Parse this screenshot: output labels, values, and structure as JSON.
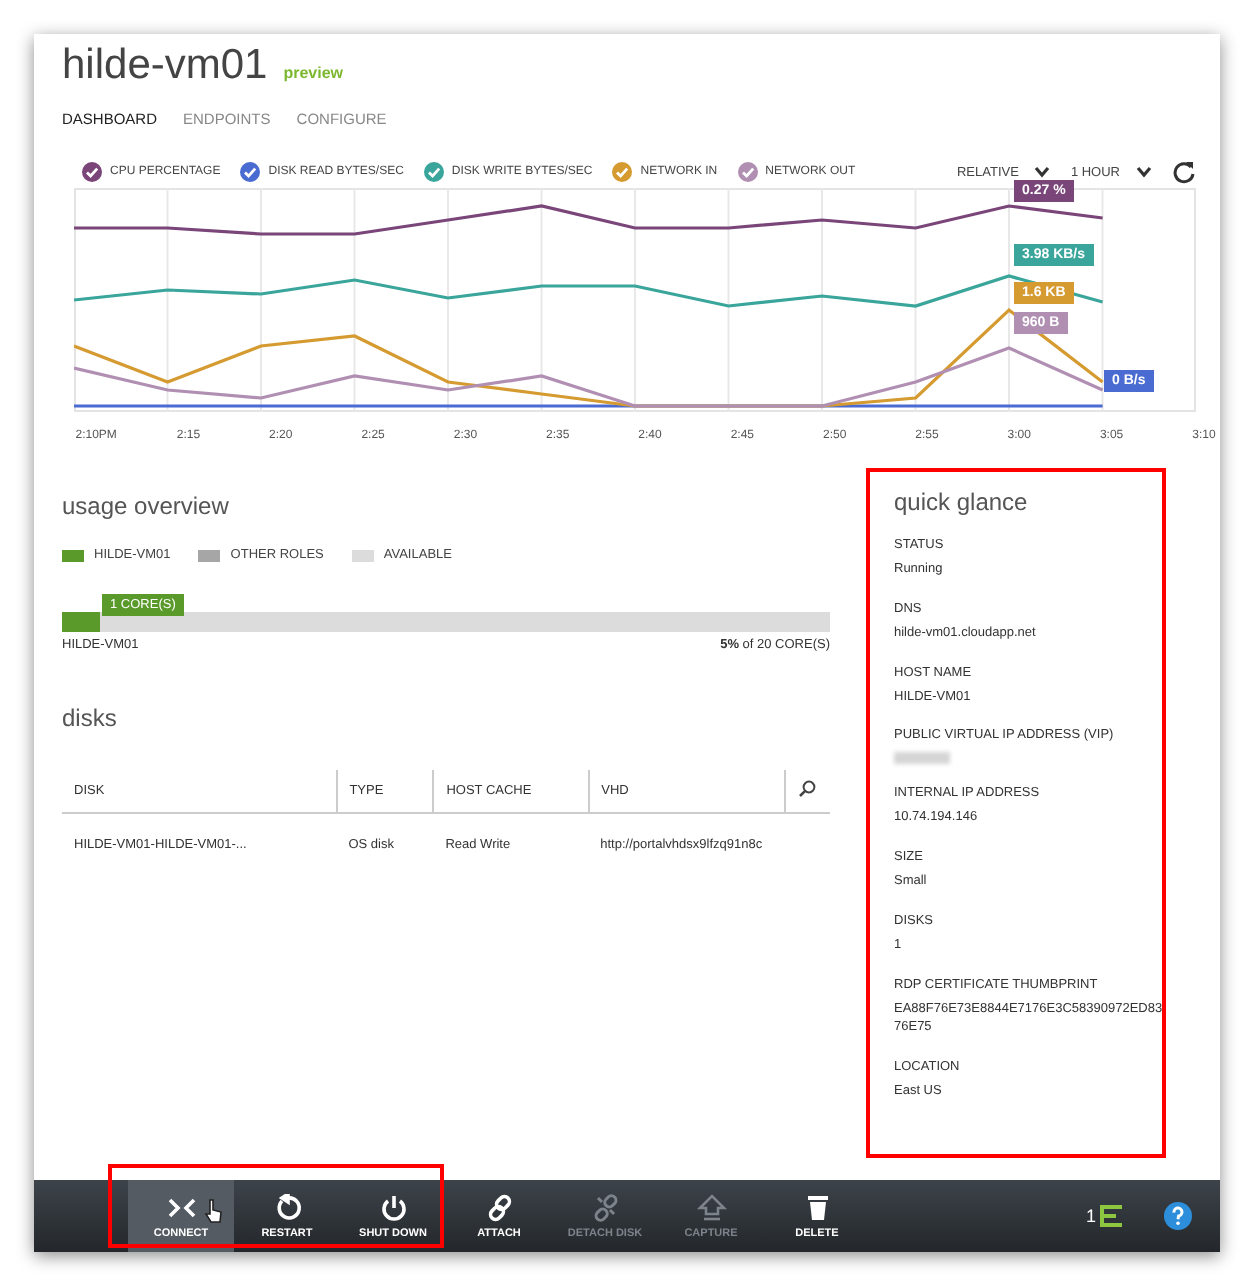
{
  "page": {
    "title": "hilde-vm01",
    "badge": "preview"
  },
  "tabs": [
    {
      "label": "DASHBOARD",
      "selected": true
    },
    {
      "label": "ENDPOINTS",
      "selected": false
    },
    {
      "label": "CONFIGURE",
      "selected": false
    }
  ],
  "legend": [
    {
      "label": "CPU PERCENTAGE",
      "color": "#7a4579",
      "checked": true
    },
    {
      "label": "DISK READ BYTES/SEC",
      "color": "#4a6bd1",
      "checked": true
    },
    {
      "label": "DISK WRITE BYTES/SEC",
      "color": "#3aa59b",
      "checked": true
    },
    {
      "label": "NETWORK IN",
      "color": "#d59a30",
      "checked": true
    },
    {
      "label": "NETWORK OUT",
      "color": "#b08fb3",
      "checked": true
    }
  ],
  "range_controls": [
    "RELATIVE",
    "1 HOUR"
  ],
  "chart": {
    "x_labels": [
      "2:10PM",
      "2:15",
      "2:20",
      "2:25",
      "2:30",
      "2:35",
      "2:40",
      "2:45",
      "2:50",
      "2:55",
      "3:00",
      "3:05",
      "3:10"
    ],
    "callouts": [
      {
        "text": "0.27 %",
        "color": "#7a4579"
      },
      {
        "text": "3.98 KB/s",
        "color": "#3aa59b"
      },
      {
        "text": "1.6 KB",
        "color": "#d59a30"
      },
      {
        "text": "960 B",
        "color": "#b08fb3"
      },
      {
        "text": "0 B/s",
        "color": "#4a6bd1"
      }
    ]
  },
  "usage_overview": {
    "title": "usage overview",
    "legend": [
      {
        "label": "HILDE-VM01",
        "color": "#5a9a2a"
      },
      {
        "label": "OTHER ROLES",
        "color": "#a6a6a6"
      },
      {
        "label": "AVAILABLE",
        "color": "#dcdcdc"
      }
    ],
    "callout": "1 CORE(S)",
    "level": 0.05,
    "bar_label": "HILDE-VM01",
    "summary": "**5%** of 20 CORE(S)"
  },
  "disks": {
    "title": "disks",
    "columns": [
      "DISK",
      "TYPE",
      "HOST CACHE",
      "VHD"
    ],
    "rows": [
      [
        "HILDE-VM01-HILDE-VM01-...",
        "OS disk",
        "Read Write",
        "http://portalvhdsx9lfzq91n8c"
      ]
    ]
  },
  "quick_glance": {
    "title": "quick glance",
    "items": [
      {
        "label": "STATUS",
        "value": "Running",
        "redacted": false
      },
      {
        "label": "DNS",
        "value": "hilde-vm01.cloudapp.net",
        "redacted": false
      },
      {
        "label": "HOST NAME",
        "value": "HILDE-VM01",
        "redacted": false
      },
      {
        "label": "PUBLIC VIRTUAL IP ADDRESS (VIP)",
        "redacted": true
      },
      {
        "label": "INTERNAL IP ADDRESS",
        "value": "10.74.194.146",
        "redacted": false
      },
      {
        "label": "SIZE",
        "value": "Small",
        "redacted": false
      },
      {
        "label": "DISKS",
        "value": "1",
        "redacted": false
      },
      {
        "label": "RDP CERTIFICATE THUMBPRINT",
        "value": "EA88F76E73E8844E7176E3C58390972ED8376E75",
        "redacted": false
      },
      {
        "label": "LOCATION",
        "value": "East US",
        "redacted": false
      }
    ]
  },
  "toolbar": {
    "buttons": [
      {
        "kind": "connect",
        "label": "CONNECT",
        "disabled": false,
        "active": true
      },
      {
        "kind": "restart",
        "label": "RESTART",
        "disabled": false,
        "active": false
      },
      {
        "kind": "shutdown",
        "label": "SHUT DOWN",
        "disabled": false,
        "active": false
      },
      {
        "kind": "attach",
        "label": "ATTACH",
        "disabled": false,
        "active": false
      },
      {
        "kind": "detach",
        "label": "DETACH DISK",
        "disabled": true,
        "active": false
      },
      {
        "kind": "capture",
        "label": "CAPTURE",
        "disabled": true,
        "active": false
      },
      {
        "kind": "delete",
        "label": "DELETE",
        "disabled": false,
        "active": false
      }
    ],
    "activity_count": "1"
  }
}
